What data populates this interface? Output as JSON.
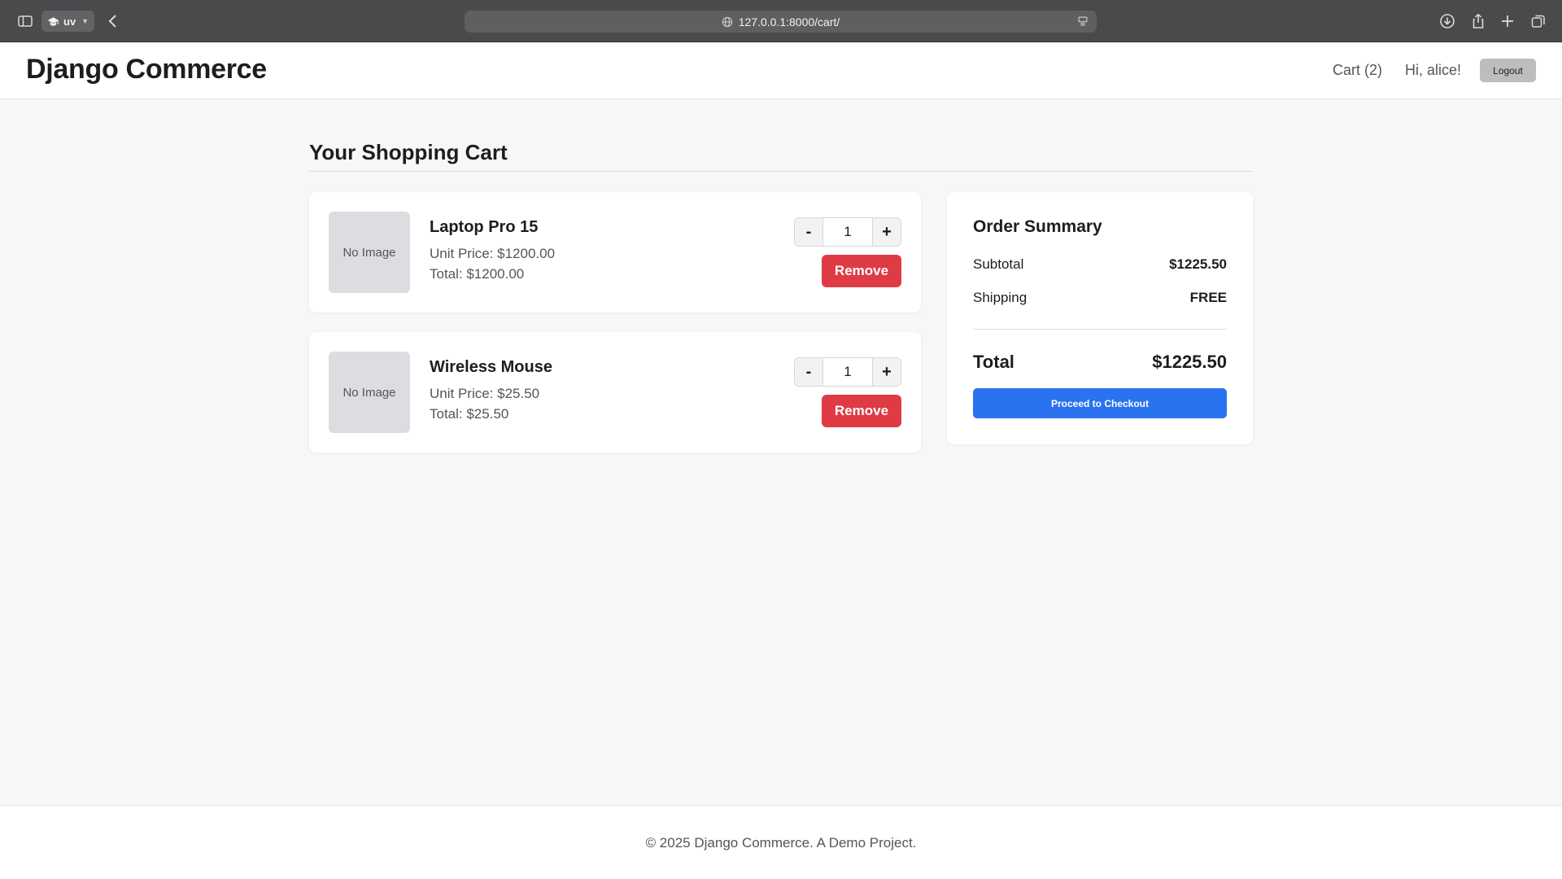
{
  "browser": {
    "tab_group_label": "uv",
    "url": "127.0.0.1:8000/cart/"
  },
  "header": {
    "brand": "Django Commerce",
    "cart_link": "Cart (2)",
    "greeting": "Hi, alice!",
    "logout_label": "Logout"
  },
  "page": {
    "title": "Your Shopping Cart"
  },
  "cart_items": [
    {
      "image_placeholder": "No Image",
      "name": "Laptop Pro 15",
      "unit_price": "Unit Price: $1200.00",
      "total": "Total: $1200.00",
      "quantity": "1",
      "minus_label": "-",
      "plus_label": "+",
      "remove_label": "Remove"
    },
    {
      "image_placeholder": "No Image",
      "name": "Wireless Mouse",
      "unit_price": "Unit Price: $25.50",
      "total": "Total: $25.50",
      "quantity": "1",
      "minus_label": "-",
      "plus_label": "+",
      "remove_label": "Remove"
    }
  ],
  "summary": {
    "title": "Order Summary",
    "subtotal_label": "Subtotal",
    "subtotal_value": "$1225.50",
    "shipping_label": "Shipping",
    "shipping_value": "FREE",
    "total_label": "Total",
    "total_value": "$1225.50",
    "checkout_label": "Proceed to Checkout"
  },
  "footer": {
    "text": "© 2025 Django Commerce. A Demo Project."
  },
  "colors": {
    "remove": "#df3b45",
    "checkout": "#2b72f0",
    "page_bg": "#f7f7f8"
  }
}
